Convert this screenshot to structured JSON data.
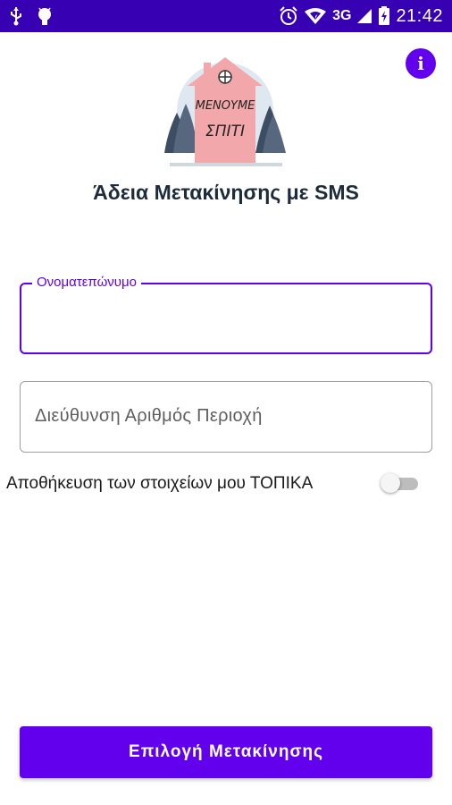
{
  "status_bar": {
    "time": "21:42",
    "network": "3G",
    "icons": [
      "usb-icon",
      "android-debug-icon",
      "alarm-icon",
      "wifi-icon",
      "signal-icon",
      "battery-charging-icon"
    ]
  },
  "header": {
    "info_button_icon": "info-icon",
    "logo_lines": [
      "ΜΕΝΟΥΜΕ",
      "ΣΠΙΤΙ"
    ],
    "title": "Άδεια Μετακίνησης με SMS"
  },
  "form": {
    "name_field": {
      "label": "Ονοματεπώνυμο",
      "value": ""
    },
    "address_field": {
      "placeholder": "Διεύθυνση Αριθμός Περιοχή",
      "value": ""
    },
    "save_locally": {
      "label": "Αποθήκευση των στοιχείων μου ΤΟΠΙΚΑ",
      "checked": false
    }
  },
  "actions": {
    "primary_label": "Επιλογή Μετακίνησης"
  },
  "colors": {
    "status_bar": "#3700b3",
    "accent": "#6200ee",
    "title_text": "#1d2b3a"
  }
}
